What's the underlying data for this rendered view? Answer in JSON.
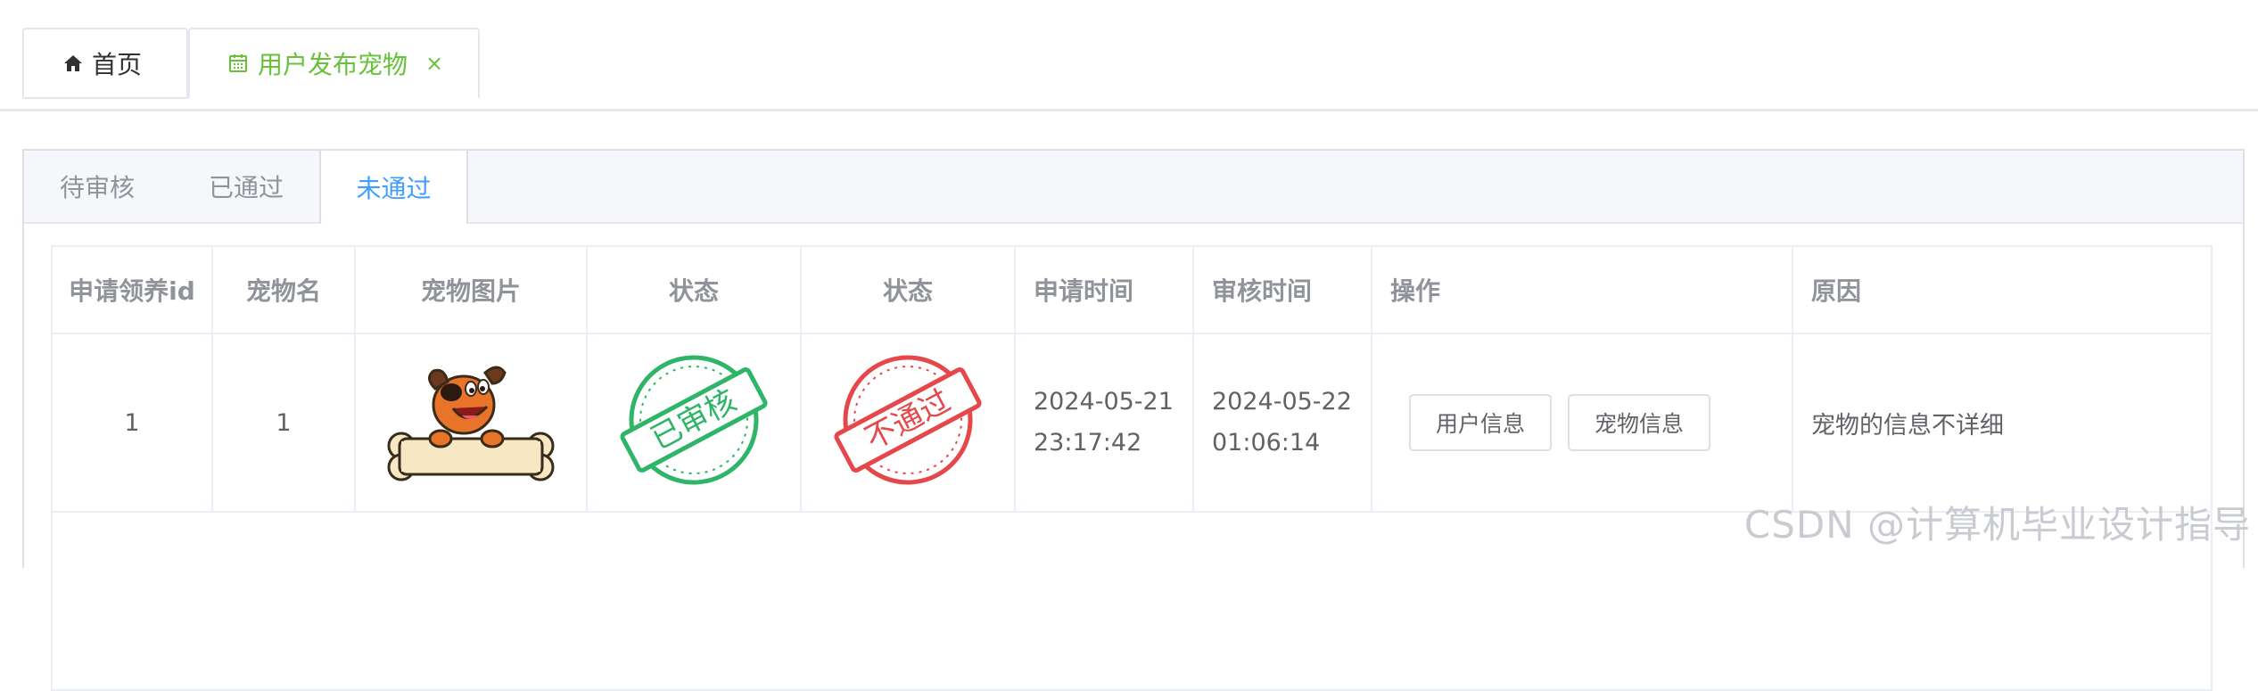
{
  "page_tabs": [
    {
      "label": "首页",
      "icon": "home-icon"
    },
    {
      "label": "用户发布宠物",
      "icon": "calendar-icon",
      "close": "×"
    }
  ],
  "status_tabs": {
    "pending": "待审核",
    "passed": "已通过",
    "rejected": "未通过",
    "active": "未通过"
  },
  "table": {
    "headers": [
      "申请领养id",
      "宠物名",
      "宠物图片",
      "状态",
      "状态",
      "申请时间",
      "审核时间",
      "操作",
      "原因"
    ],
    "rows": [
      {
        "id": "1",
        "pet_name": "1",
        "pet_image": "dog-holding-bone",
        "status_stamp": "已审核",
        "result_stamp": "不通过",
        "apply_time_date": "2024-05-21",
        "apply_time_clock": "23:17:42",
        "review_time_date": "2024-05-22",
        "review_time_clock": "01:06:14",
        "actions": {
          "user_info": "用户信息",
          "pet_info": "宠物信息"
        },
        "reason": "宠物的信息不详细"
      }
    ]
  },
  "colors": {
    "accent": "#409eff",
    "green": "#67c23a",
    "stamp_green": "#2fb567",
    "stamp_red": "#e6474a"
  },
  "watermark": "CSDN @计算机毕业设计指导"
}
